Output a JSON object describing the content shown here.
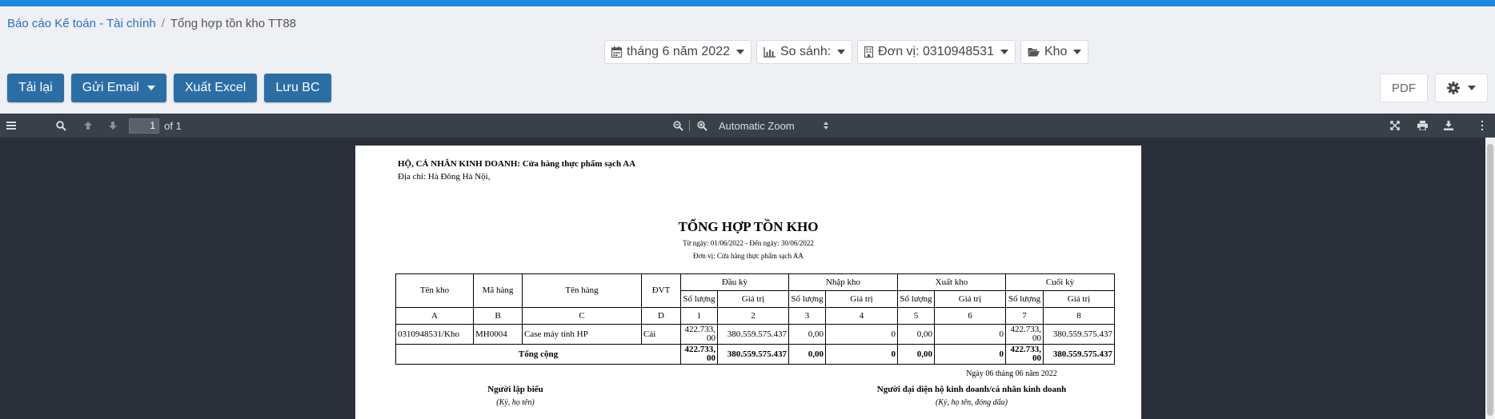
{
  "breadcrumb": {
    "parent": "Báo cáo Kế toán - Tài chính",
    "current": "Tổng hợp tồn kho TT88"
  },
  "filters": {
    "period": "tháng 6 năm 2022",
    "compare": "So sánh:",
    "unit": "Đơn vị: 0310948531",
    "warehouse": "Kho"
  },
  "actions": {
    "reload": "Tải lại",
    "send_email": "Gửi Email",
    "export_excel": "Xuất Excel",
    "save_report": "Lưu BC",
    "pdf": "PDF"
  },
  "viewer": {
    "page_number": "1",
    "page_total": "of 1",
    "zoom": "Automatic Zoom"
  },
  "report": {
    "business_line": "HỘ, CÁ NHÂN KINH DOANH: Cửa hàng thực phẩm sạch AA",
    "address": "Địa chỉ: Hà Đông Hà Nội,",
    "title": "TỔNG HỢP TỒN KHO",
    "date_range": "Từ ngày: 01/06/2022 - Đến ngày: 30/06/2022",
    "unit_line": "Đơn vị: Cửa hàng thực phẩm sạch AA",
    "headers": {
      "kho": "Tên kho",
      "ma": "Mã hàng",
      "ten": "Tên hàng",
      "dvt": "ĐVT",
      "dau_ky": "Đầu kỳ",
      "nhap": "Nhập kho",
      "xuat": "Xuất kho",
      "cuoi": "Cuối kỳ",
      "sl": "Số lượng",
      "gt": "Giá trị"
    },
    "col_codes": [
      "A",
      "B",
      "C",
      "D",
      "1",
      "2",
      "3",
      "4",
      "5",
      "6",
      "7",
      "8"
    ],
    "row": {
      "kho": "0310948531/Kho",
      "ma": "MH0004",
      "ten": "Case máy tính HP",
      "dvt": "Cái",
      "sl1_a": "422.733,",
      "sl1_b": "00",
      "gt1": "380.559.575.437",
      "sl2": "0,00",
      "gt2": "0",
      "sl3": "0,00",
      "gt3": "0",
      "sl4_a": "422.733,",
      "sl4_b": "00",
      "gt4": "380.559.575.437"
    },
    "total": {
      "label": "Tổng cộng",
      "sl1_a": "422.733,",
      "sl1_b": "00",
      "gt1": "380.559.575.437",
      "sl2": "0,00",
      "gt2": "0",
      "sl3": "0,00",
      "gt3": "0",
      "sl4_a": "422.733,",
      "sl4_b": "00",
      "gt4": "380.559.575.437"
    },
    "sign_date": "Ngày 06 tháng 06 năm 2022",
    "preparer": "Người lập biểu",
    "preparer_note": "(Ký, họ tên)",
    "representative": "Người đại diện hộ kinh doanh/cá nhân kinh doanh",
    "representative_note": "(Ký, họ tên, đóng dấu)"
  }
}
